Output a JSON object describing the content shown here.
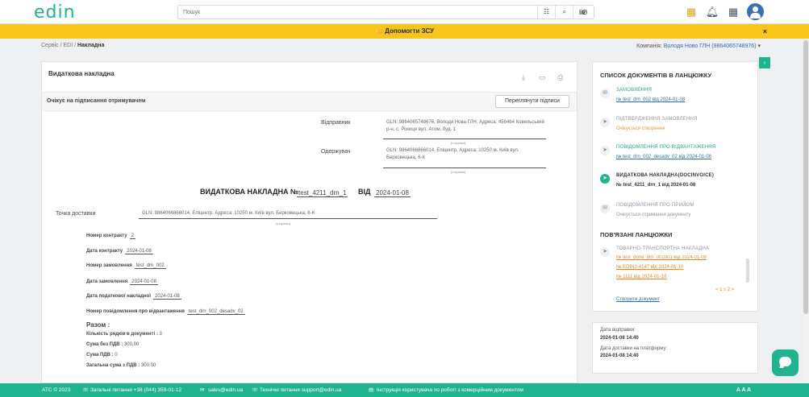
{
  "header": {
    "logo": "edin",
    "search_placeholder": "Пошук",
    "icons": [
      "filter-icon",
      "search-icon",
      "save-icon",
      "clear-icon",
      "calendar-icon",
      "bell-icon",
      "apps-grid-icon",
      "avatar-icon"
    ]
  },
  "banner": {
    "text": "🔱 Допомогти ЗСУ",
    "close": "×"
  },
  "breadcrumb": {
    "items": [
      "Сервіс",
      "EDI",
      "Накладна"
    ]
  },
  "company": {
    "label": "Компанія:",
    "value": "Володя Ново ГЛН (9864065748976)"
  },
  "document": {
    "title": "Видаткова накладна",
    "status": "Очікує на підписання отримувачем",
    "signatures_button": "Переглянути підписи",
    "sender_label": "Відправник",
    "sender_value": "GLN: 9864065748676, Володя Нова ГЛН, Адреса: 456464 Ковельський р-н, с. Рокиця вул. Атом, буд. 1",
    "receiver_label": "Одержувач",
    "receiver_value": "GLN: 9864066866014, Епіцентр, Адреса: 10250 м. Київ вул. Берковецька, 6-К",
    "caption": "(сторінка)",
    "heading": "ВИДАТКОВА НАКЛАДНА №",
    "number": "test_4211_drn_1",
    "from_label": "ВІД",
    "date": "2024-01-08",
    "delivery_label": "Точка доставки",
    "delivery_value": "GLN: 9864066866014, Епіцентр, Адреса: 10250 м. Київ вул. Берковецька, 6-К",
    "delivery_caption": "(сторінка)",
    "rows": [
      {
        "label": "Номер контракту",
        "value": "2"
      },
      {
        "label": "Дата контракту",
        "value": "2024-01-08"
      },
      {
        "label": "Номер замовлення",
        "value": "test_drn_002"
      },
      {
        "label": "Дата замовлення",
        "value": "2024-01-08"
      },
      {
        "label": "Дата податкової накладної",
        "value": "2024-01-08"
      },
      {
        "label": "Номер повідомлення про відвантаження",
        "value": "test_drn_002_desadv_02"
      }
    ],
    "totals_title": "Разом :",
    "totals": [
      {
        "label": "Кількість рядків в документі :",
        "value": "3"
      },
      {
        "label": "Сума без ПДВ :",
        "value": "300.00"
      },
      {
        "label": "Сума ПДВ :",
        "value": "0"
      },
      {
        "label": "Загальна сума з ПДВ :",
        "value": "300.00"
      }
    ]
  },
  "chain": {
    "title": "СПИСОК ДОКУМЕНТІВ В ЛАНЦЮЖКУ",
    "items": [
      {
        "name": "ЗАМОВЛЕННЯ",
        "sub": "№ test_drn_002 від 2024-01-08"
      },
      {
        "name": "ПІДТВЕРДЖЕННЯ ЗАМОВЛЕННЯ",
        "sub": "Очікується створення"
      },
      {
        "name": "ПОВІДОМЛЕННЯ ПРО ВІДВАНТАЖЕННЯ",
        "sub": "№ test_drn_002_desadv_02 від 2024-01-08"
      },
      {
        "name": "ВИДАТКОВА НАКЛАДНА(DOCINVOICE)",
        "sub": "№ test_4211_drn_1 від 2024-01-08"
      },
      {
        "name": "ПОВІДОМЛЕННЯ ПРО ПРИЙОМ",
        "sub": "Очікується отримання документу"
      }
    ],
    "linked_title": "ПОВ'ЯЗАНІ ЛАНЦЮЖКИ",
    "linked_name": "ТОВАРНО-ТРАНСПОРТНА НАКЛАДНА",
    "linked_items": [
      "№ test_done_drn_002001 від 2024-01-09",
      "№ EDIN2-4147 від 2024-01-10",
      "№ 1111 від 2024-01-10"
    ],
    "pager": "< 1 з 2 >",
    "create_link": "Створити документ"
  },
  "dates": {
    "sent_label": "Дата відправки:",
    "sent_value": "2024-01-08 14:40",
    "delivered_label": "Дата доставки на платформу:",
    "delivered_value": "2024-01-08 14:40"
  },
  "footer": {
    "copyright": "АТС © 2023",
    "general": "Загальні питання +38 (044) 359-01-12",
    "email": "sales@edin.ua",
    "tech": "Технічні питання support@edin.ua",
    "instructions": "Інструкція користувача по роботі з комерційним документом",
    "font_sizes": "A A A"
  },
  "colors": {
    "brand": "#1fb48f",
    "banner": "#f8c51c",
    "link": "#2d6db3",
    "warning": "#e79a2a"
  }
}
